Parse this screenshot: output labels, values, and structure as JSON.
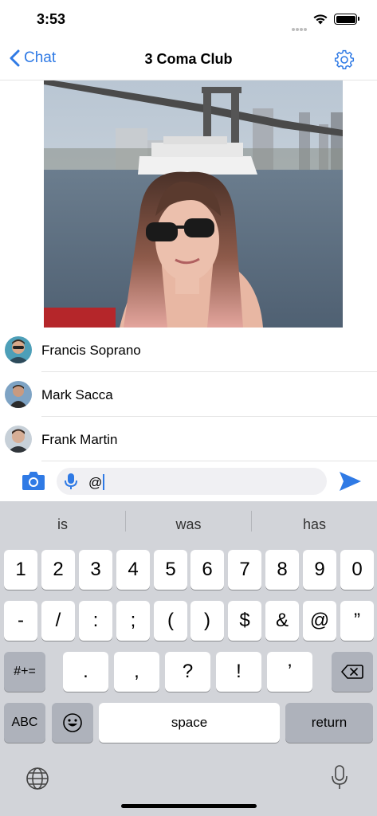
{
  "status_bar": {
    "time": "3:53"
  },
  "nav": {
    "back_label": "Chat",
    "title": "3 Coma Club"
  },
  "mentions": [
    {
      "name": "Francis Soprano"
    },
    {
      "name": "Mark Sacca"
    },
    {
      "name": "Frank Martin"
    }
  ],
  "input": {
    "text": "@"
  },
  "keyboard": {
    "suggestions": [
      "is",
      "was",
      "has"
    ],
    "row1": [
      "1",
      "2",
      "3",
      "4",
      "5",
      "6",
      "7",
      "8",
      "9",
      "0"
    ],
    "row2": [
      "-",
      "/",
      ":",
      ";",
      "(",
      ")",
      "$",
      "&",
      "@",
      "”"
    ],
    "row3_mode": "#+=",
    "row3": [
      ".",
      ",",
      "?",
      "!",
      "’"
    ],
    "abc_label": "ABC",
    "space_label": "space",
    "return_label": "return"
  },
  "colors": {
    "accent": "#2f7ae5",
    "keyboard_bg": "#d2d4d9",
    "key_dark": "#aeb2bb"
  },
  "icons": {
    "back": "chevron-left-icon",
    "settings": "gear-icon",
    "camera": "camera-icon",
    "mic": "microphone-icon",
    "send": "send-icon",
    "backspace": "backspace-icon",
    "emoji": "emoji-icon",
    "globe": "globe-icon",
    "dictation": "microphone-icon"
  }
}
